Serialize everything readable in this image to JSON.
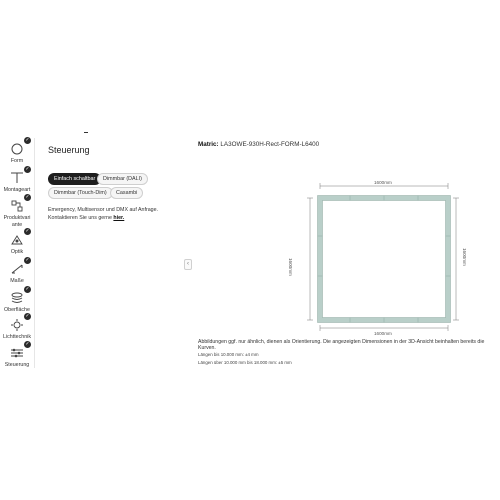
{
  "sidebar": {
    "items": [
      {
        "label": "Form",
        "icon": "circle-shape-icon",
        "done": true
      },
      {
        "label": "Montageart",
        "icon": "pendant-mount-icon",
        "done": true
      },
      {
        "label": "Produktvari ante",
        "icon": "product-variant-icon",
        "done": true
      },
      {
        "label": "Optik",
        "icon": "optics-icon",
        "done": true
      },
      {
        "label": "Maße",
        "icon": "dimensions-icon",
        "done": true
      },
      {
        "label": "Oberfläche",
        "icon": "surface-layers-icon",
        "done": true
      },
      {
        "label": "Lichttechnik",
        "icon": "light-technology-icon",
        "done": true
      },
      {
        "label": "Steuerung",
        "icon": "control-sliders-icon",
        "done": true
      }
    ],
    "check_glyph": "✓"
  },
  "panel": {
    "title": "Steuerung",
    "options": [
      "Einfach schaltbar",
      "Dimmbar (DALI)",
      "Dimmbar (Touch-Dim)",
      "Casambi"
    ],
    "selected": "Einfach schaltbar",
    "info_line1": "Emergency, Multisensor und DMX auf Anfrage.",
    "info_line2_prefix": "Kontaktieren Sie uns gerne",
    "info_link": "hier."
  },
  "collapse_glyph": "‹",
  "preview": {
    "matric_label": "Matric:",
    "matric_code": "LA3OWE-930H-Rect-FORM-L6400",
    "dim_top": "1600mm",
    "dim_bottom": "1600mm",
    "dim_left": "1600mm",
    "dim_right": "1600mm",
    "note": "Abbildungen ggf. nur ähnlich, dienen als Orientierung. Die angezeigten Dimensionen in der 3D-Ansicht beinhalten bereits die Kurven.",
    "tolerance_1": "Längen bis 10.000 mm: ±4 mm",
    "tolerance_2": "Längen über 10.000 mm bis 18.000 mm: ±5 mm"
  },
  "colors": {
    "frame": "#b9cfc9",
    "frame_inner": "#8fa9a2",
    "active_chip": "#1e1e1e"
  }
}
